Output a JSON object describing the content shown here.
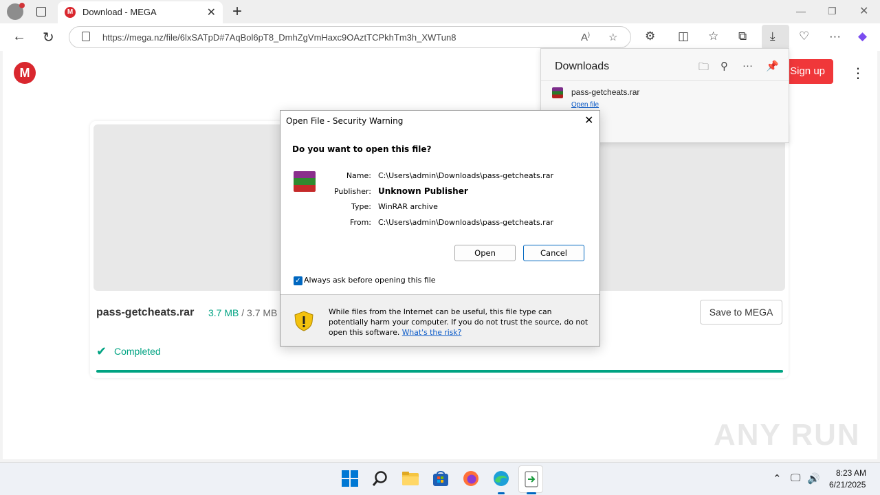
{
  "browser": {
    "tab_title": "Download - MEGA",
    "tab_favicon": "M",
    "url": "https://mega.nz/file/6lxSATpD#7AqBol6pT8_DmhZgVmHaxc9OAztTCPkhTm3h_XWTun8"
  },
  "page": {
    "logo": "M",
    "signup_label": "Sign up",
    "file_name": "pass-getcheats.rar",
    "size_downloaded": "3.7 MB",
    "size_separator": "/",
    "size_total": "3.7 MB",
    "save_label": "Save to MEGA",
    "status": "Completed",
    "progress_fraction": 1.0,
    "watermark": "ANY RUN",
    "accent": "#00a382",
    "brand": "#d9272e"
  },
  "downloads": {
    "title": "Downloads",
    "item_name": "pass-getcheats.rar",
    "item_action": "Open file"
  },
  "dialog": {
    "title": "Open File - Security Warning",
    "question": "Do you want to open this file?",
    "name_label": "Name:",
    "name_value": "C:\\Users\\admin\\Downloads\\pass-getcheats.rar",
    "publisher_label": "Publisher:",
    "publisher_value": "Unknown Publisher",
    "type_label": "Type:",
    "type_value": "WinRAR archive",
    "from_label": "From:",
    "from_value": "C:\\Users\\admin\\Downloads\\pass-getcheats.rar",
    "open_label": "Open",
    "cancel_label": "Cancel",
    "always_ask_label": "Always ask before opening this file",
    "always_ask_checked": true,
    "warning_text": "While files from the Internet can be useful, this file type can potentially harm your computer. If you do not trust the source, do not open this software.",
    "risk_link": "What's the risk?"
  },
  "taskbar": {
    "time": "8:23 AM",
    "date": "6/21/2025"
  }
}
